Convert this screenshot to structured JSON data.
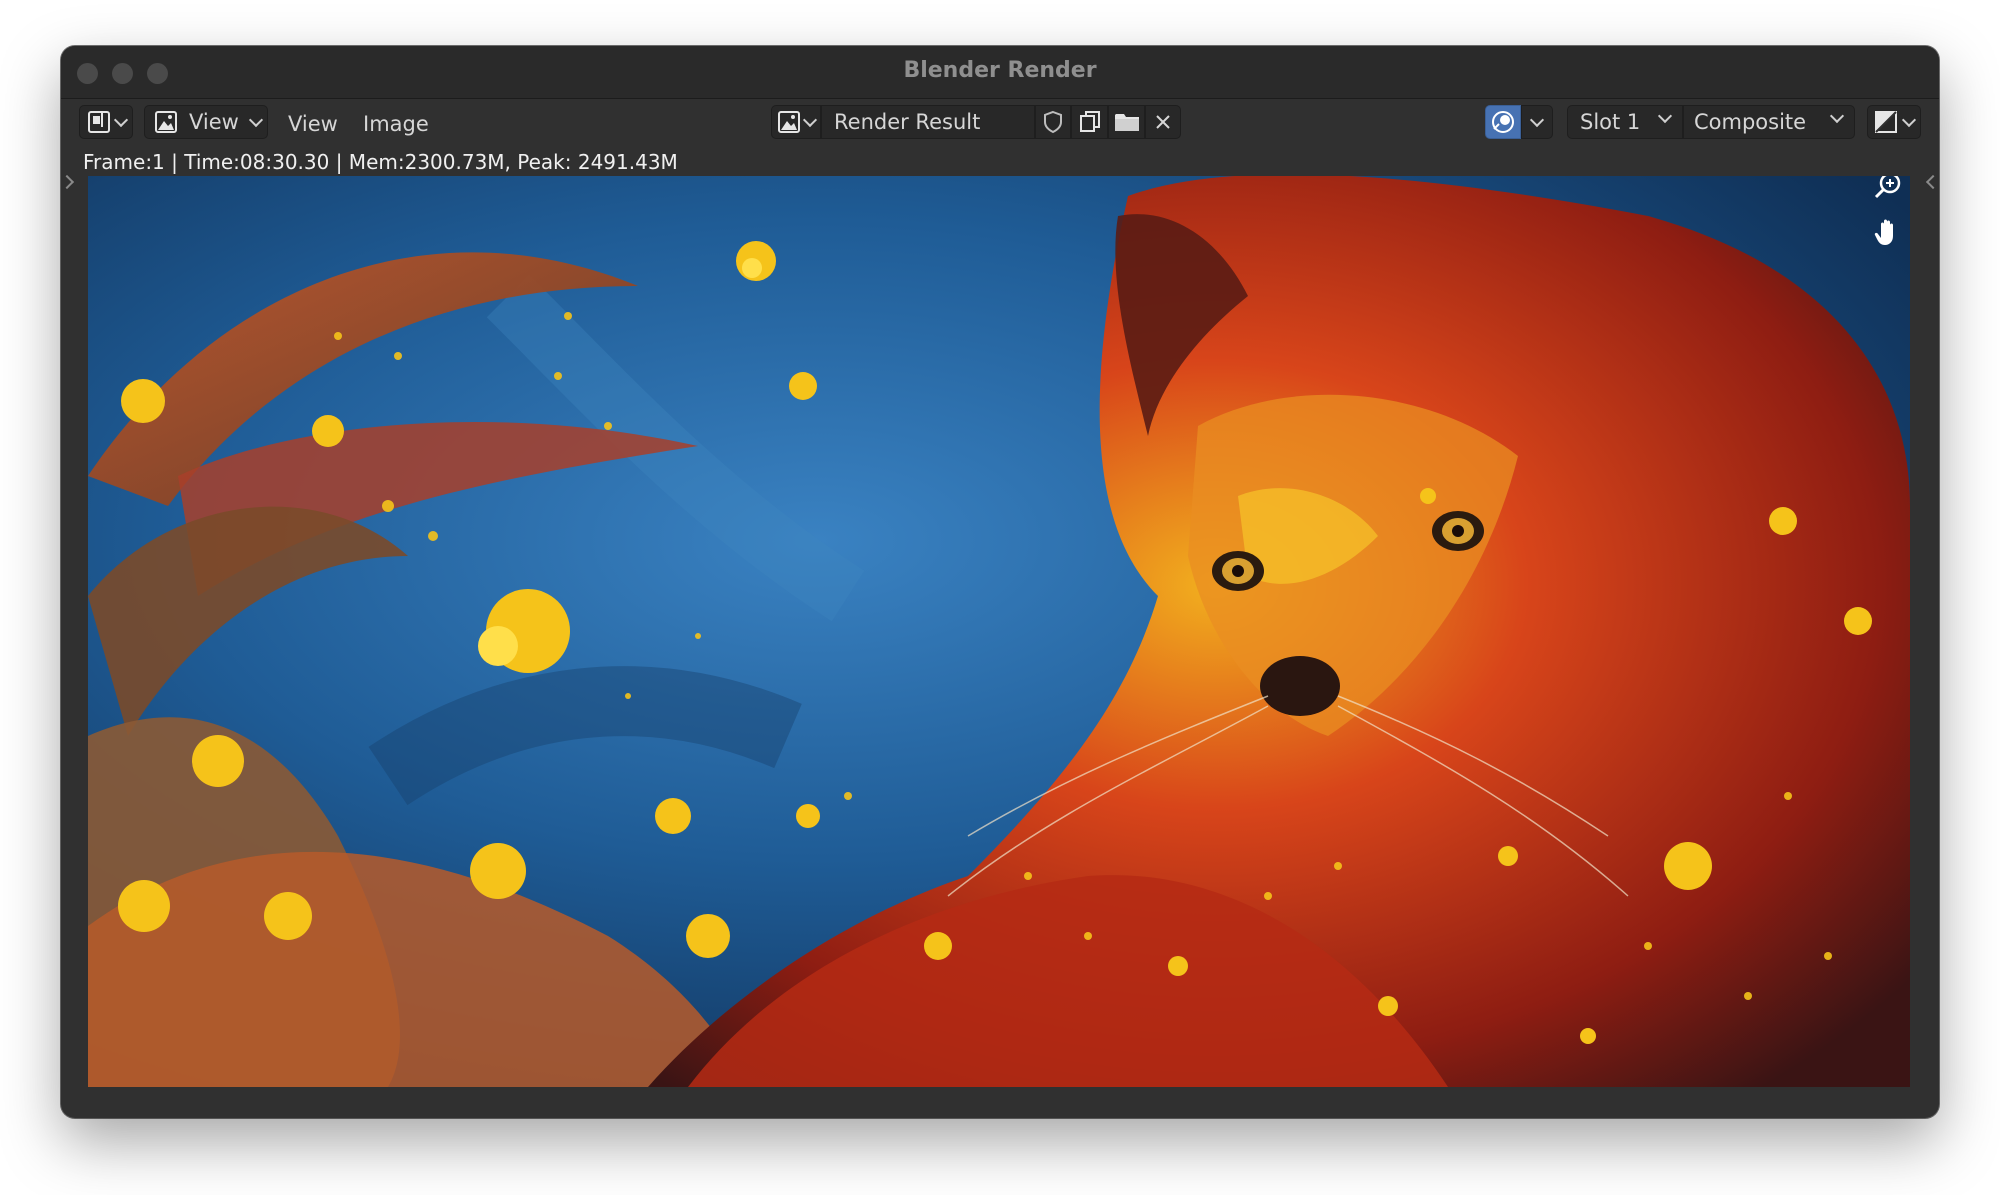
{
  "window": {
    "title": "Blender Render"
  },
  "header": {
    "menus": {
      "view_dropdown": "View",
      "view": "View",
      "image": "Image"
    },
    "image_name": "Render Result",
    "slot": "Slot 1",
    "layer": "Composite"
  },
  "status": {
    "text": "Frame:1 | Time:08:30.30 | Mem:2300.73M, Peak: 2491.43M"
  },
  "icons": {
    "editor_type": "image-editor-icon",
    "mode": "view-mode-icon",
    "browse_image": "browse-image-icon",
    "fake_user": "shield-icon",
    "new_image": "duplicate-icon",
    "open_image": "folder-icon",
    "unlink": "close-icon",
    "gizmo_toggle": "gizmo-icon",
    "display_channels": "display-channels-icon",
    "zoom": "zoom-icon",
    "pan": "hand-icon"
  },
  "colors": {
    "background": "#303030",
    "accent": "#4772b3",
    "render_sky": "#1f4f82"
  }
}
